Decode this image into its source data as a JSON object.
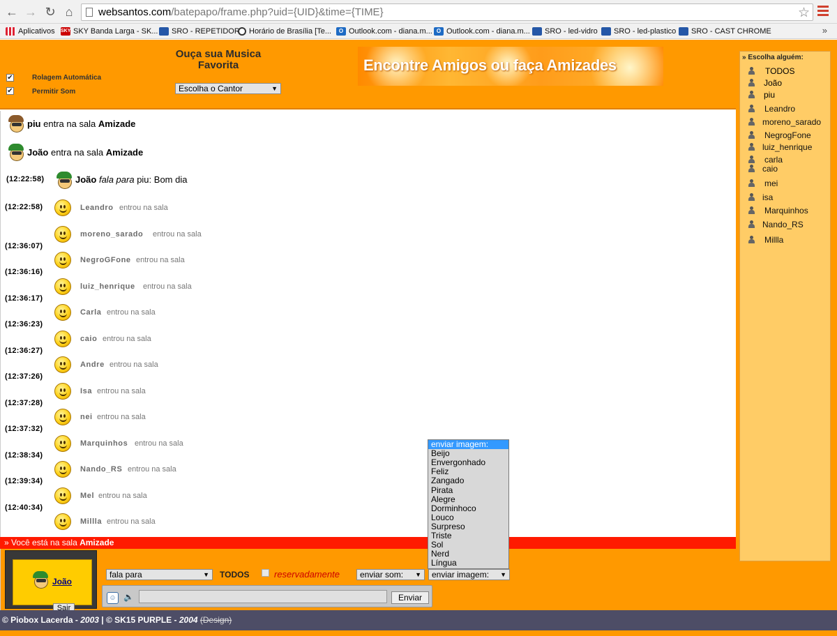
{
  "browser": {
    "url_host": "websantos.com",
    "url_path": "/batepapo/frame.php?uid={UID}&time={TIME}",
    "bookmarks": [
      {
        "label": "Aplicativos",
        "icon": "apps-grid-icon"
      },
      {
        "label": "SKY Banda Larga - SK...",
        "icon": "sky-icon"
      },
      {
        "label": "SRO - REPETIDOR",
        "icon": "sro-icon"
      },
      {
        "label": "Horário de Brasília [Te...",
        "icon": "clock-icon"
      },
      {
        "label": "Outlook.com - diana.m...",
        "icon": "outlook-icon"
      },
      {
        "label": "Outlook.com - diana.m...",
        "icon": "outlook-icon"
      },
      {
        "label": "SRO - led-vidro",
        "icon": "sro-icon"
      },
      {
        "label": "SRO - led-plastico",
        "icon": "sro-icon"
      },
      {
        "label": "SRO - CAST CHROME",
        "icon": "sro-icon"
      }
    ],
    "more": "»"
  },
  "header": {
    "auto_scroll_label": "Rolagem Automática",
    "allow_sound_label": "Permitir Som",
    "check_mark": "✔",
    "music_title": "Ouça sua Musica Favorita",
    "singer_select": "Escolha o Cantor",
    "banner_text": "Encontre Amigos ou faça Amizades"
  },
  "chat": {
    "joins": [
      {
        "nick": "piu",
        "text": "entra na sala",
        "room": "Amizade"
      },
      {
        "nick": "João",
        "text": "entra na sala",
        "room": "Amizade"
      }
    ],
    "message": {
      "time": "(12:22:58)",
      "from": "João",
      "verb": "fala para",
      "to": "piu:",
      "text": "Bom dia"
    },
    "entries_text": "entrou na sala",
    "entries": [
      {
        "time": "(12:22:58)",
        "nick": "Leandro"
      },
      {
        "time": "(12:36:07)",
        "nick": "moreno_sarado"
      },
      {
        "time": "(12:36:16)",
        "nick": "NegroGFone"
      },
      {
        "time": "(12:36:17)",
        "nick": "luiz_henrique"
      },
      {
        "time": "(12:36:23)",
        "nick": "Carla"
      },
      {
        "time": "(12:36:27)",
        "nick": "caio"
      },
      {
        "time": "(12:37:26)",
        "nick": "Andre"
      },
      {
        "time": "(12:37:28)",
        "nick": "Isa"
      },
      {
        "time": "(12:37:32)",
        "nick": "nei"
      },
      {
        "time": "(12:38:34)",
        "nick": "Marquinhos"
      },
      {
        "time": "(12:39:34)",
        "nick": "Nando_RS"
      },
      {
        "time": "(12:40:34)",
        "nick": "Mel"
      },
      {
        "time": "",
        "nick": "Millla"
      }
    ]
  },
  "room_bar": {
    "prefix": "» Você está na sala",
    "room": "Amizade"
  },
  "input": {
    "user_name": "João",
    "sair_label": "Sair",
    "speech_select": "fala para",
    "target": "TODOS",
    "private_label": "reservadamente",
    "sound_select": "enviar som:",
    "image_select": "enviar imagem:",
    "emoji_symbol": "☺",
    "sound_symbol": "🔈",
    "send_label": "Enviar"
  },
  "image_dropdown": {
    "options": [
      "enviar imagem:",
      "Beijo",
      "Envergonhado",
      "Feliz",
      "Zangado",
      "Pirata",
      "Alegre",
      "Dorminhoco",
      "Louco",
      "Surpreso",
      "Triste",
      "Sol",
      "Nerd",
      "Língua"
    ],
    "selected": "enviar imagem:"
  },
  "sidebar": {
    "title": "» Escolha alguém:",
    "users": [
      {
        "name": "TODOS",
        "link": true
      },
      {
        "name": "João",
        "link": true
      },
      {
        "name": "piu",
        "link": true
      },
      {
        "name": "Leandro",
        "link": false
      },
      {
        "name": "moreno_sarado",
        "link": false
      },
      {
        "name": "NegrogFone",
        "link": false
      },
      {
        "name": "luiz_henrique",
        "link": false
      },
      {
        "name": "carla",
        "link": false
      },
      {
        "name": "caio",
        "link": false
      },
      {
        "name": "mei",
        "link": false
      },
      {
        "name": "isa",
        "link": false
      },
      {
        "name": "Marquinhos",
        "link": false
      },
      {
        "name": "Nando_RS",
        "link": false
      },
      {
        "name": "Millla",
        "link": false
      }
    ]
  },
  "footer": {
    "part1": "© Piobox Lacerda -",
    "year1": "2003",
    "sep": "| © SK15 PURPLE -",
    "year2": "2004",
    "design": "(Design)"
  },
  "colors": {
    "accent": "#ff9900",
    "room_bar": "#ff1a00",
    "footer": "#4d4d66",
    "sidebar": "#ffcc66"
  }
}
